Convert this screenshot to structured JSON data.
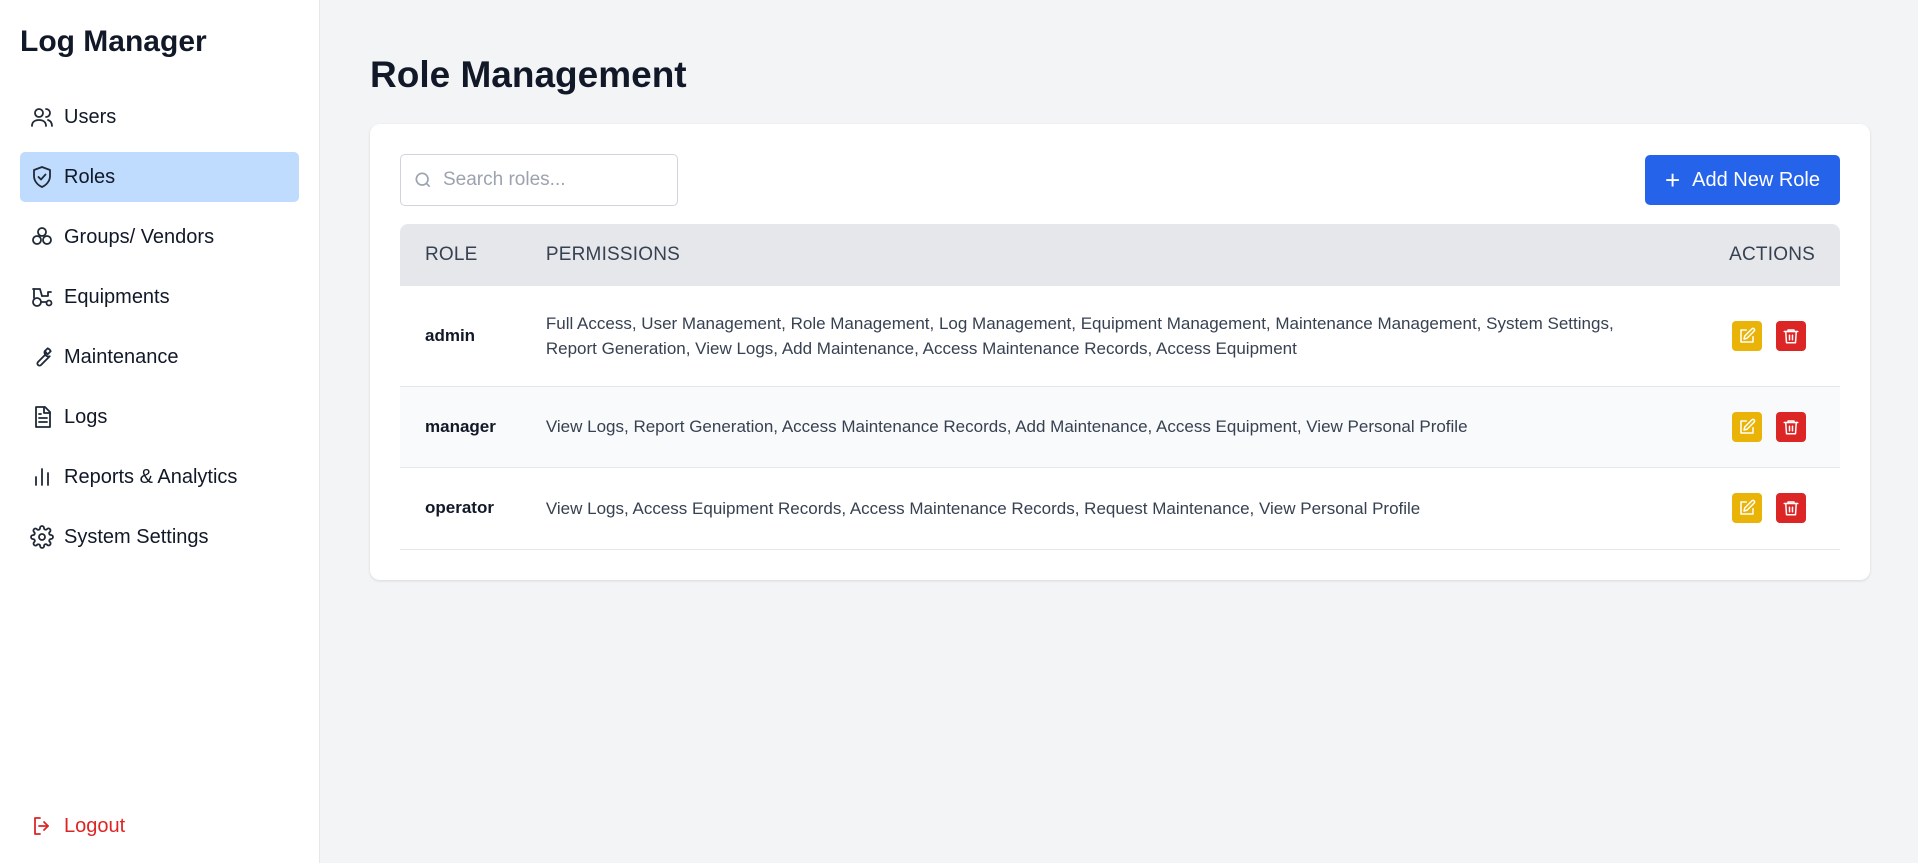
{
  "app": {
    "title": "Log Manager"
  },
  "sidebar": {
    "items": [
      {
        "label": "Users",
        "icon": "users-icon",
        "active": false
      },
      {
        "label": "Roles",
        "icon": "shield-icon",
        "active": true
      },
      {
        "label": "Groups/ Vendors",
        "icon": "boxes-icon",
        "active": false
      },
      {
        "label": "Equipments",
        "icon": "tractor-icon",
        "active": false
      },
      {
        "label": "Maintenance",
        "icon": "wrench-icon",
        "active": false
      },
      {
        "label": "Logs",
        "icon": "document-icon",
        "active": false
      },
      {
        "label": "Reports & Analytics",
        "icon": "bar-chart-icon",
        "active": false
      },
      {
        "label": "System Settings",
        "icon": "gear-icon",
        "active": false
      }
    ],
    "logout_label": "Logout"
  },
  "main": {
    "title": "Role Management",
    "search_placeholder": "Search roles...",
    "add_button_label": "Add New Role",
    "table": {
      "headers": [
        "ROLE",
        "PERMISSIONS",
        "ACTIONS"
      ],
      "rows": [
        {
          "role": "admin",
          "permissions": "Full Access, User Management, Role Management, Log Management, Equipment Management, Maintenance Management, System Settings, Report Generation, View Logs, Add Maintenance, Access Maintenance Records, Access Equipment"
        },
        {
          "role": "manager",
          "permissions": "View Logs, Report Generation, Access Maintenance Records, Add Maintenance, Access Equipment, View Personal Profile"
        },
        {
          "role": "operator",
          "permissions": "View Logs, Access Equipment Records, Access Maintenance Records, Request Maintenance, View Personal Profile"
        }
      ]
    }
  },
  "colors": {
    "accent": "#2563eb",
    "active_nav": "#bfdbfe",
    "edit": "#eab308",
    "delete": "#dc2626",
    "logout": "#dc2626"
  }
}
